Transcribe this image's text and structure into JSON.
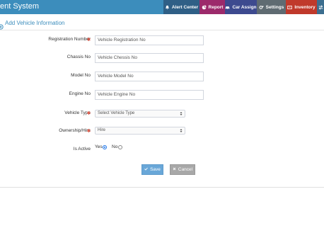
{
  "app": {
    "title": "ent System"
  },
  "nav": {
    "items": [
      {
        "label": "Alert Center",
        "bg": "#2f5f86",
        "icon": "bell-icon"
      },
      {
        "label": "Report",
        "bg": "#9c2a6b",
        "icon": "pie-chart-icon"
      },
      {
        "label": "Car Assign",
        "bg": "#3d4a8f",
        "icon": "car-icon"
      },
      {
        "label": "Settings",
        "bg": "#5f6b72",
        "icon": "gears-icon"
      },
      {
        "label": "Inventory",
        "bg": "#c0392b",
        "icon": "inventory-icon"
      },
      {
        "label": "",
        "bg": "#3c6e8f",
        "icon": "exchange-icon"
      }
    ]
  },
  "panel": {
    "title": "Add Vehicle Information"
  },
  "form": {
    "registration": {
      "label": "Registration Number",
      "placeholder": "Vehicle Registration No"
    },
    "chassis": {
      "label": "Chassis No",
      "placeholder": "Vehicle Chessis No"
    },
    "model": {
      "label": "Model No",
      "placeholder": "Vehicle Model No"
    },
    "engine": {
      "label": "Engine No",
      "placeholder": "Vehicle Engine No"
    },
    "vehicle_type": {
      "label": "Vehicle Type",
      "selected": "Select Vehicle Type"
    },
    "ownership": {
      "label": "Ownership/Hire",
      "selected": "Hire"
    },
    "is_active": {
      "label": "Is Active",
      "yes": "Yes",
      "no": "No",
      "value": "Yes"
    }
  },
  "buttons": {
    "save": "Save",
    "cancel": "Cancel"
  },
  "colors": {
    "header": "#3c8dbc",
    "required": "#dd4b39",
    "save": "#69a7d8",
    "cancel": "#a8a8a8"
  }
}
